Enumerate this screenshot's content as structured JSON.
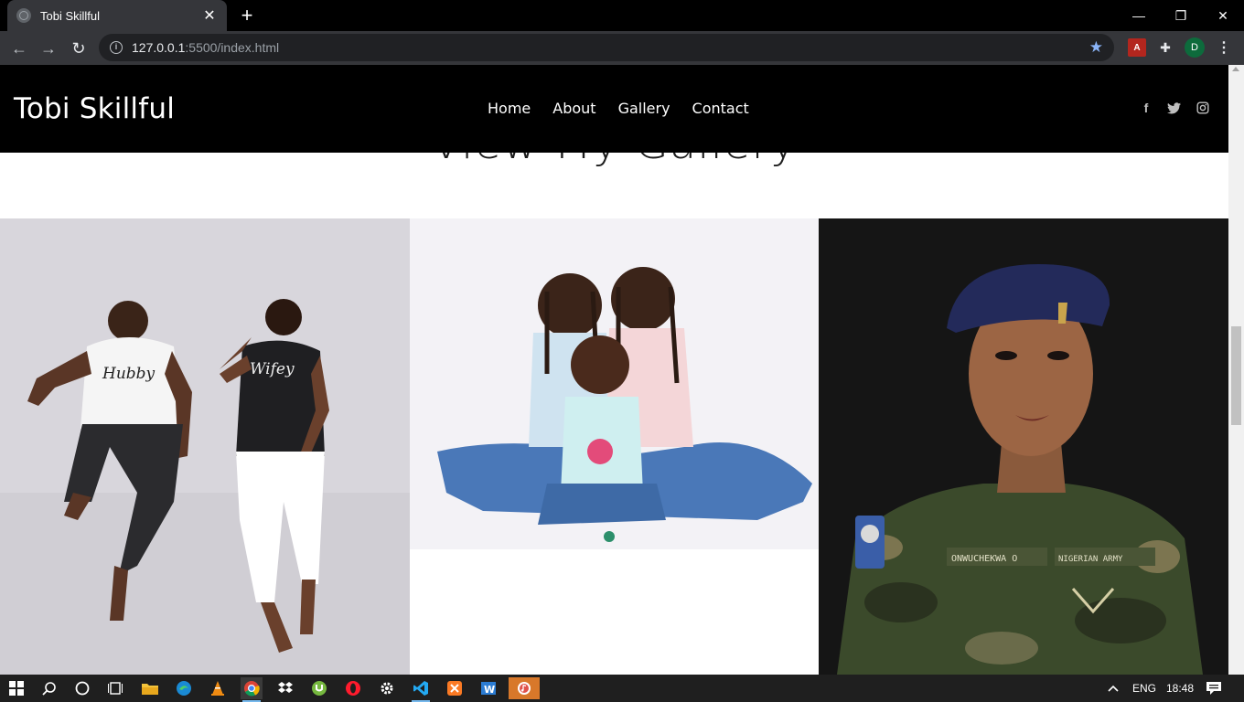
{
  "browser": {
    "tab_title": "Tobi Skillful",
    "tab_close": "✕",
    "new_tab": "+",
    "url_host": "127.0.0.1",
    "url_path": ":5500/index.html",
    "profile_initial": "D",
    "window_controls": {
      "minimize": "—",
      "restore": "❐",
      "close": "✕"
    },
    "nav": {
      "back": "←",
      "forward": "→",
      "reload": "↻"
    },
    "bookmark_star": "★",
    "pdf_label": "A",
    "menu": "⋮",
    "puzzle": "✚"
  },
  "site": {
    "brand": "Tobi Skillful",
    "nav_items": [
      "Home",
      "About",
      "Gallery",
      "Contact"
    ],
    "social": {
      "facebook": "f",
      "twitter": "t",
      "instagram": "◎"
    },
    "section_heading": "View My Gallery"
  },
  "gallery": {
    "photos": [
      {
        "alt": "Couple in Hubby and Wifey t-shirts jumping",
        "shirt_left": "Hubby",
        "shirt_right": "Wifey"
      },
      {
        "alt": "Three smiling children sitting together"
      },
      {
        "alt": "Portrait of a woman in military uniform and beret",
        "name_tape": "ONWUCHEKWA O",
        "army_tape": "NIGERIAN ARMY"
      }
    ]
  },
  "taskbar": {
    "language": "ENG",
    "time": "18:48"
  },
  "colors": {
    "page_bg": "#ffffff",
    "header_bg": "#000000",
    "chrome_dark": "#35363a",
    "taskbar": "#1f1f1f"
  }
}
